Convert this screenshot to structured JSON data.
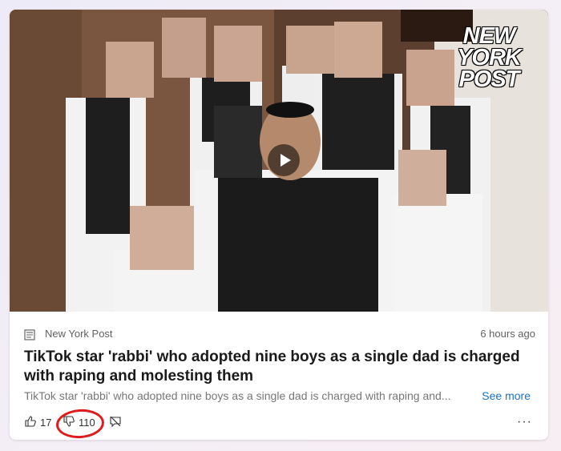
{
  "article": {
    "image": {
      "logo_lines": [
        "NEW",
        "YORK",
        "POST"
      ]
    },
    "source": "New York Post",
    "timestamp": "6 hours ago",
    "headline": "TikTok star 'rabbi' who adopted nine boys as a single dad is charged with raping and molesting them",
    "summary": "TikTok star 'rabbi' who adopted nine boys as a single dad is charged with raping and...",
    "see_more_label": "See more"
  },
  "reactions": {
    "like_count": "17",
    "dislike_count": "110",
    "more_label": "···"
  },
  "colors": {
    "link": "#1a73c8",
    "annotation": "#e01b1b"
  },
  "icons": {
    "like": "thumbs-up-icon",
    "dislike": "thumbs-down-icon",
    "hide": "hide-icon",
    "play": "play-icon",
    "source": "newspaper-icon"
  }
}
